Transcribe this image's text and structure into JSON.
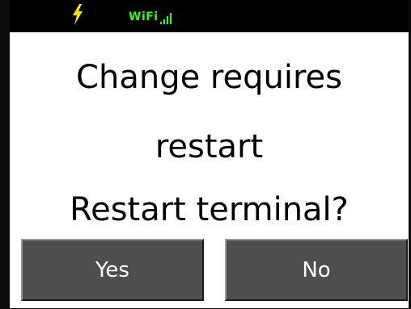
{
  "status_bar": {
    "power_icon": "lightning-bolt-icon",
    "wifi_label": "WiFi",
    "signal_icon": "signal-strength-icon",
    "colors": {
      "bolt": "#ffe000",
      "wifi": "#2fff00",
      "background": "#000000"
    }
  },
  "dialog": {
    "message_line_1": "Change requires",
    "message_line_2": "restart",
    "message_line_3": "Restart terminal?",
    "yes_label": "Yes",
    "no_label": "No",
    "button_color": "#4e4e4e"
  }
}
